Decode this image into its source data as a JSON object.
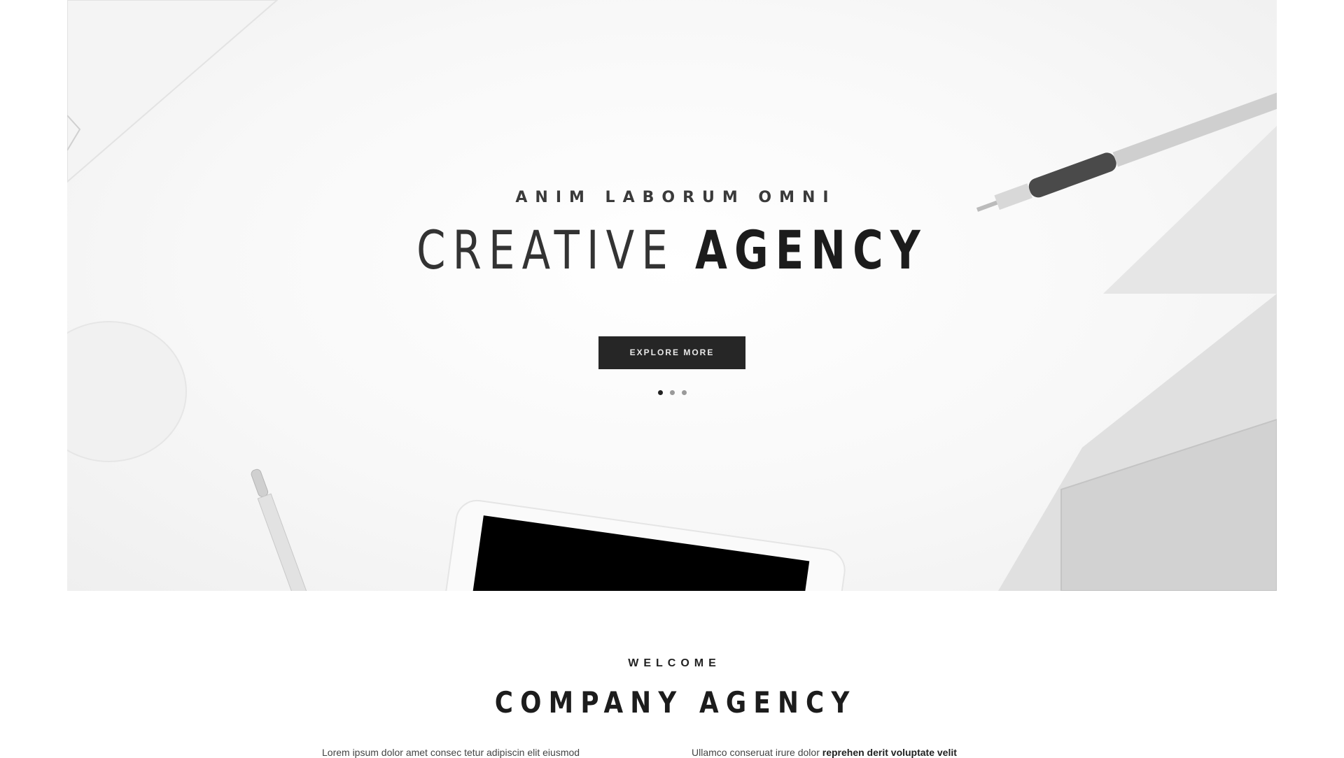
{
  "hero": {
    "subtitle": "ANIM LABORUM OMNI",
    "title_light": "CREATIVE",
    "title_bold": "AGENCY",
    "button_label": "EXPLORE MORE",
    "slides": 3,
    "active_slide": 1
  },
  "welcome": {
    "label": "WELCOME",
    "title": "COMPANY AGENCY"
  },
  "intro": {
    "left": "Lorem ipsum dolor amet consec tetur adipiscin elit eiusmod",
    "right_plain": "Ullamco conseruat irure dolor",
    "right_bold": "reprehen derit voluptate velit"
  }
}
